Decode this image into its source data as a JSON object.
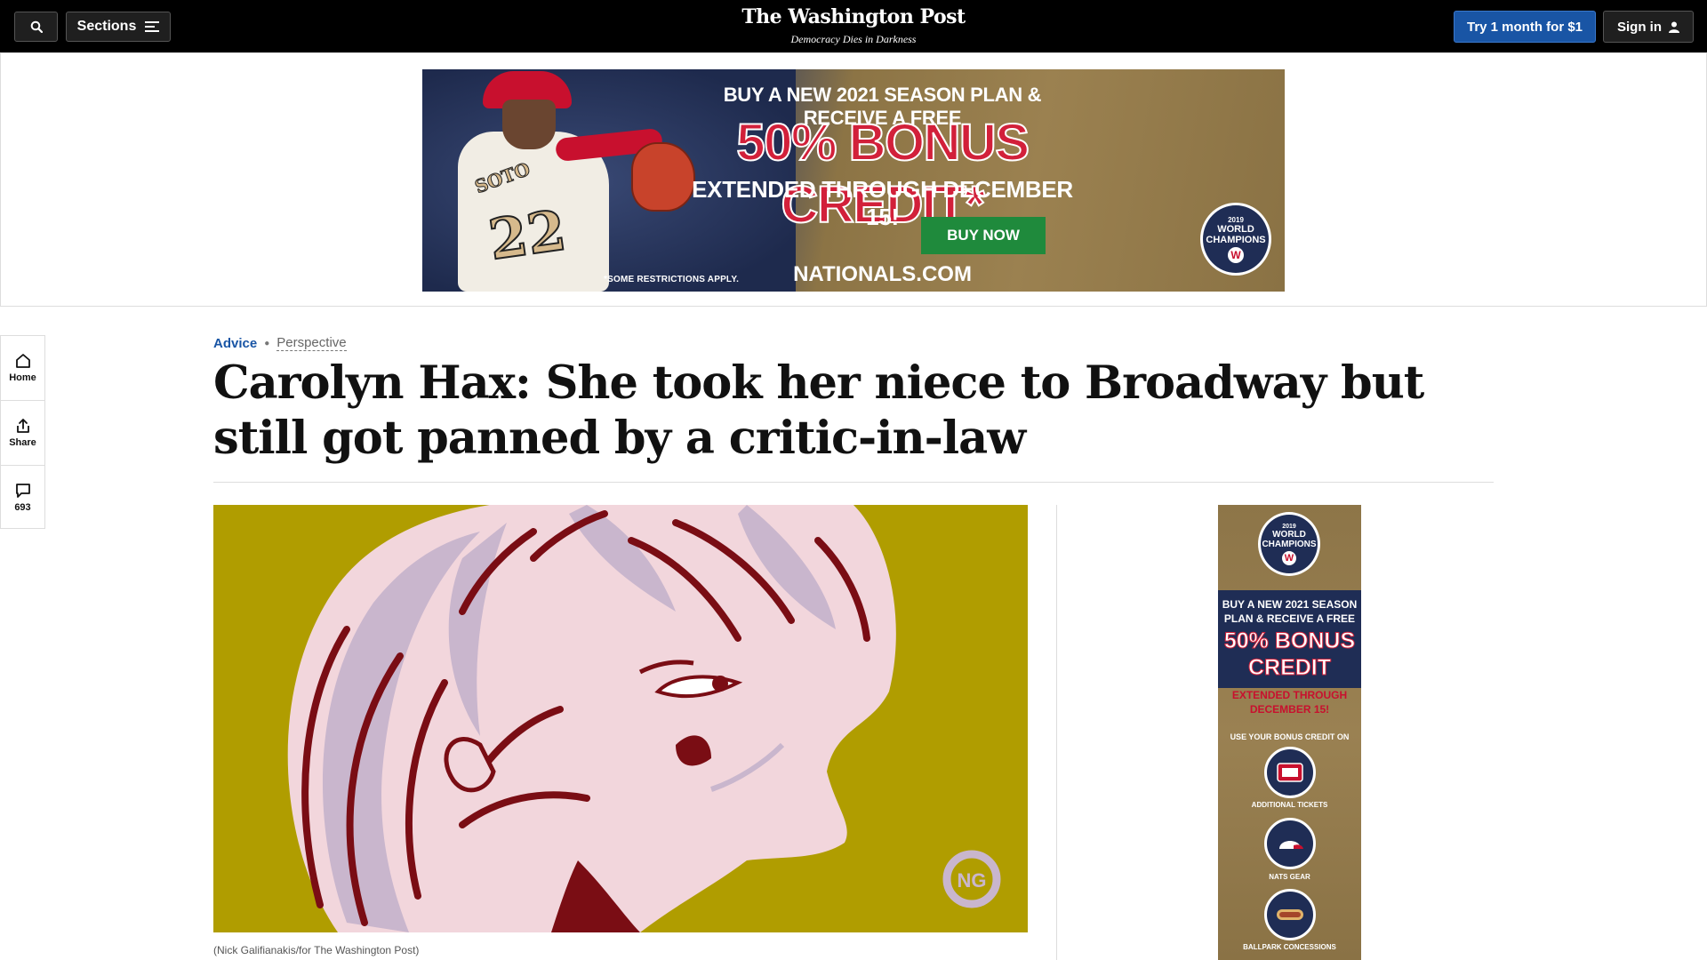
{
  "header": {
    "sections_label": "Sections",
    "brand_name": "The Washington Post",
    "brand_tagline": "Democracy Dies in Darkness",
    "try_label": "Try 1 month for $1",
    "signin_label": "Sign in"
  },
  "top_ad": {
    "line1": "BUY A NEW 2021 SEASON PLAN & RECEIVE A FREE",
    "line2": "50% BONUS CREDIT*",
    "line3": "EXTENDED THROUGH DECEMBER 15!",
    "cta": "BUY NOW",
    "site": "NATIONALS.COM",
    "restrictions": "*SOME RESTRICTIONS APPLY.",
    "jersey_name": "SOTO",
    "jersey_number": "22",
    "badge_year": "2019",
    "badge_text": "WORLD CHAMPIONS",
    "badge_logo": "W"
  },
  "rail": {
    "home_label": "Home",
    "share_label": "Share",
    "comments_count": "693"
  },
  "article": {
    "kicker_section": "Advice",
    "kicker_type": "Perspective",
    "headline": "Carolyn Hax: She took her niece to Broadway but still got panned by a critic-in-law",
    "caption": "(Nick Galifianakis/for The Washington Post)",
    "art_signature": "NG"
  },
  "side_ad": {
    "badge_year": "2019",
    "badge_text": "WORLD CHAMPIONS",
    "badge_logo": "W",
    "line1": "BUY A NEW 2021 SEASON PLAN & RECEIVE A FREE",
    "line2": "50% BONUS CREDIT",
    "line3": "EXTENDED THROUGH DECEMBER 15!",
    "line4": "USE YOUR BONUS CREDIT ON",
    "item1": "ADDITIONAL TICKETS",
    "item2": "NATS GEAR",
    "item3": "BALLPARK CONCESSIONS"
  },
  "colors": {
    "nav_bg": "#000000",
    "accent_blue": "#1955a5",
    "art_mustard": "#b09d00",
    "nats_red": "#c8102e",
    "nats_navy": "#1f2d55"
  }
}
